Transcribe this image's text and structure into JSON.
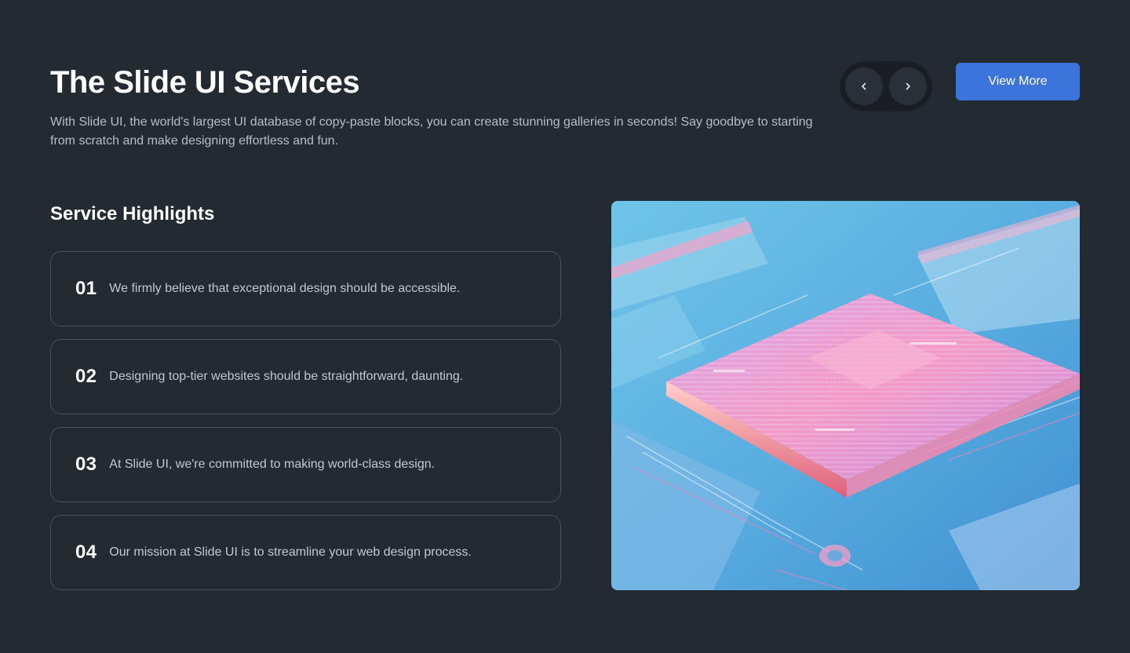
{
  "header": {
    "title": "The Slide UI Services",
    "subtitle": "With Slide UI, the world's largest UI database of copy-paste blocks, you can create stunning galleries in seconds! Say goodbye to starting from scratch and make designing effortless and fun."
  },
  "controls": {
    "prev_icon": "chevron-left-icon",
    "next_icon": "chevron-right-icon",
    "view_more_label": "View More"
  },
  "highlights": {
    "title": "Service Highlights",
    "items": [
      {
        "number": "01",
        "text": "We firmly believe that exceptional design should be accessible."
      },
      {
        "number": "02",
        "text": "Designing top-tier websites should be straightforward, daunting."
      },
      {
        "number": "03",
        "text": "At Slide UI, we're committed to making world-class design."
      },
      {
        "number": "04",
        "text": "Our mission at Slide UI is to streamline your web design process."
      }
    ]
  },
  "hero_image": {
    "subject": "circuit-chip-illustration"
  },
  "colors": {
    "background": "#242a31",
    "accent": "#3b74db",
    "card_border": "#4a5058",
    "body_text": "#b8bdc4"
  }
}
